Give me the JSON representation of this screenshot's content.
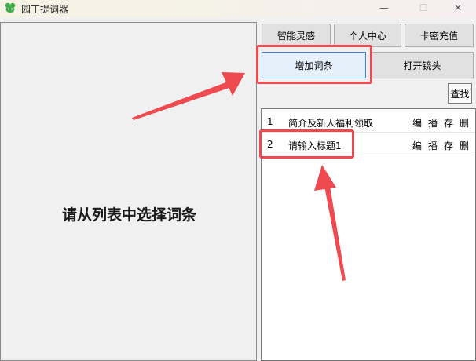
{
  "window": {
    "title": "园丁提词器",
    "minimize_glyph": "—",
    "maximize_glyph": "☐",
    "close_glyph": "✕"
  },
  "placeholder_text": "请从列表中选择词条",
  "toolbar": {
    "zhineng_label": "智能灵感",
    "geren_label": "个人中心",
    "kami_label": "卡密充值",
    "add_label": "增加词条",
    "camera_label": "打开镜头",
    "search_label": "查找"
  },
  "search": {
    "value": ""
  },
  "list": {
    "rows": [
      {
        "num": "1",
        "title": "简介及新人福利领取",
        "edit": "编",
        "play": "播",
        "save": "存",
        "delete": "删"
      },
      {
        "num": "2",
        "title": "请输入标题1",
        "edit": "编",
        "play": "播",
        "save": "存",
        "delete": "删"
      }
    ]
  },
  "colors": {
    "annotation": "#ee4a4f",
    "accent_border": "#3b7fd6",
    "app_icon": "#3db04a"
  },
  "icons": {
    "app": "app-logo-icon"
  }
}
